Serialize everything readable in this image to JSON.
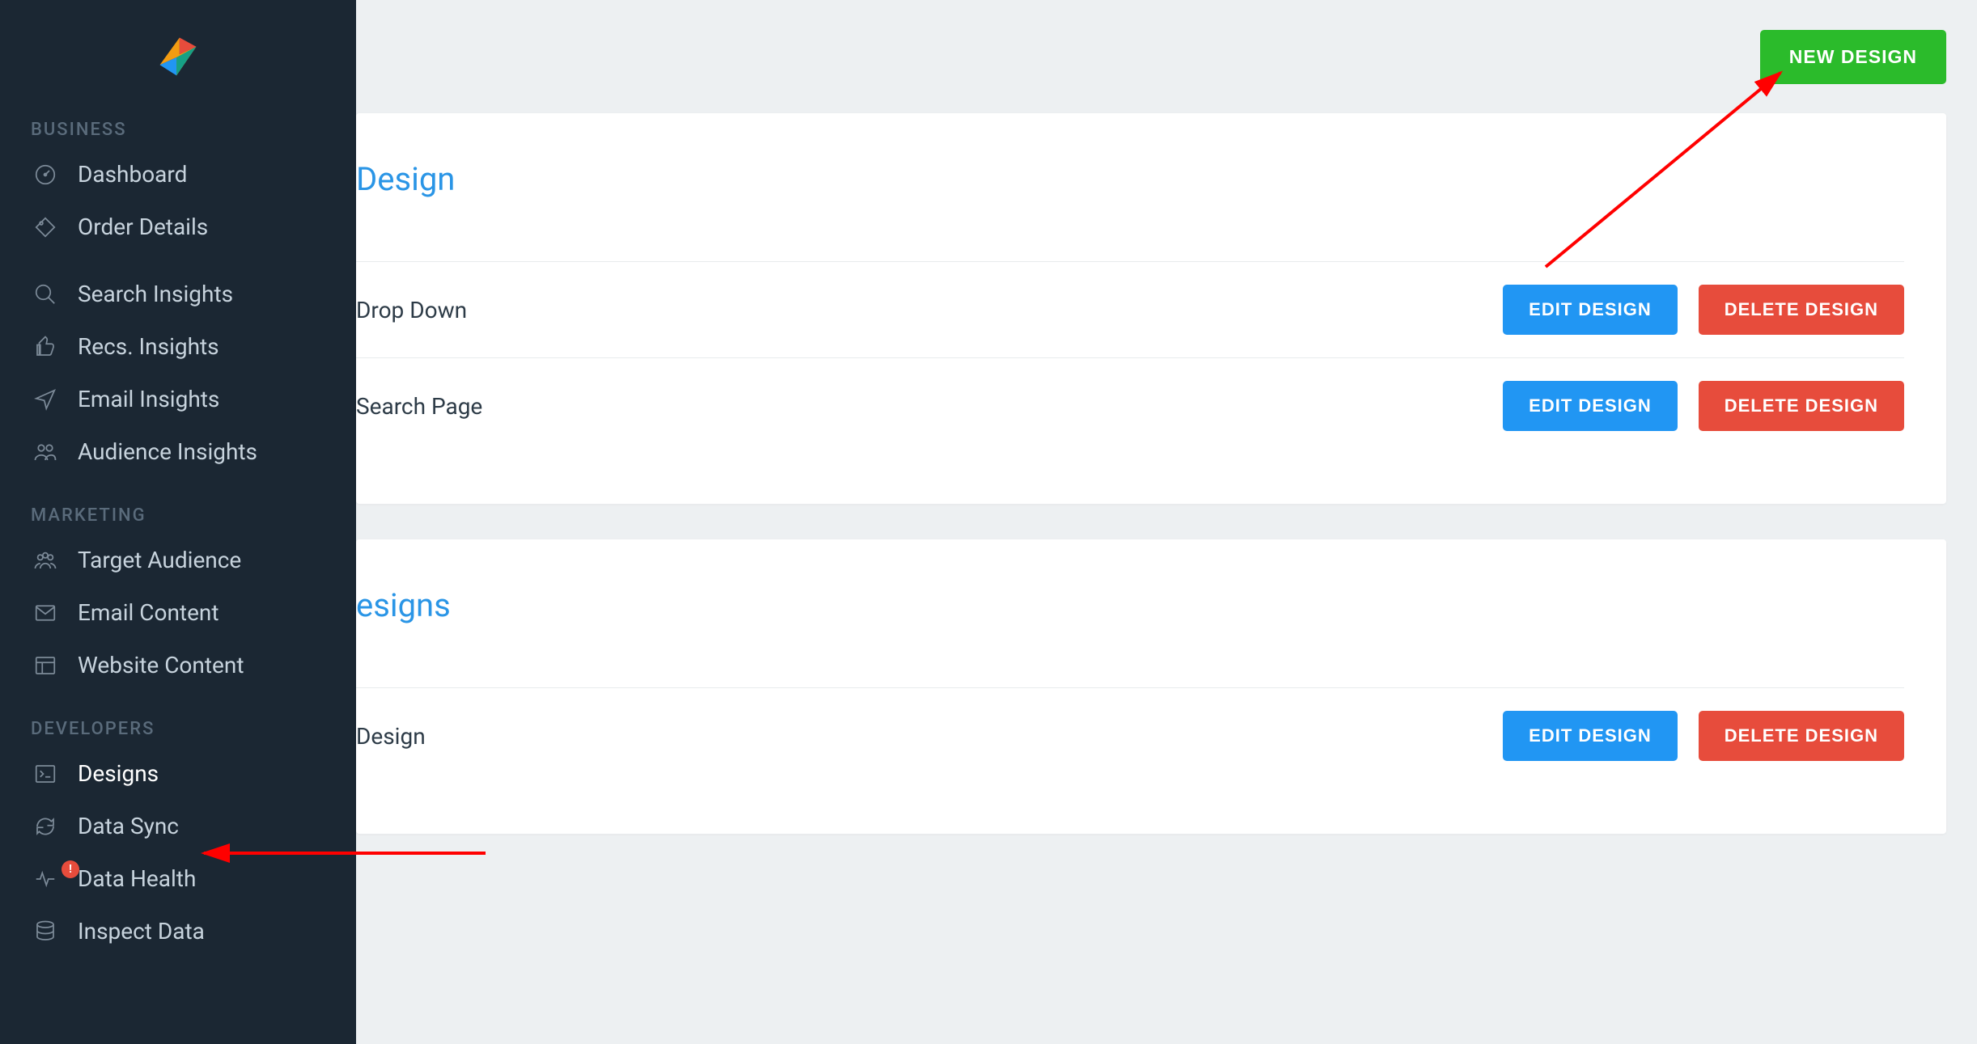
{
  "topbar": {
    "new_design_label": "NEW DESIGN"
  },
  "row_buttons": {
    "edit": "EDIT DESIGN",
    "delete": "DELETE DESIGN"
  },
  "cards": [
    {
      "title": "Design",
      "rows": [
        {
          "label": "Drop Down"
        },
        {
          "label": "Search Page"
        }
      ]
    },
    {
      "title": "esigns",
      "rows": [
        {
          "label": "Design"
        }
      ]
    }
  ],
  "sidebar": {
    "sections": [
      {
        "title": "BUSINESS",
        "items": [
          {
            "label": "Dashboard",
            "icon": "gauge-icon"
          },
          {
            "label": "Order Details",
            "icon": "tag-icon"
          },
          {
            "label": "Search Insights",
            "icon": "search-icon"
          },
          {
            "label": "Recs. Insights",
            "icon": "thumbs-up-icon"
          },
          {
            "label": "Email Insights",
            "icon": "paper-plane-icon"
          },
          {
            "label": "Audience Insights",
            "icon": "people-icon"
          }
        ]
      },
      {
        "title": "MARKETING",
        "items": [
          {
            "label": "Target Audience",
            "icon": "group-icon"
          },
          {
            "label": "Email Content",
            "icon": "envelope-icon"
          },
          {
            "label": "Website Content",
            "icon": "layout-icon"
          }
        ]
      },
      {
        "title": "DEVELOPERS",
        "items": [
          {
            "label": "Designs",
            "icon": "terminal-icon",
            "active": true
          },
          {
            "label": "Data Sync",
            "icon": "sync-icon"
          },
          {
            "label": "Data Health",
            "icon": "activity-icon",
            "alert": true
          },
          {
            "label": "Inspect Data",
            "icon": "database-icon"
          }
        ]
      }
    ]
  }
}
